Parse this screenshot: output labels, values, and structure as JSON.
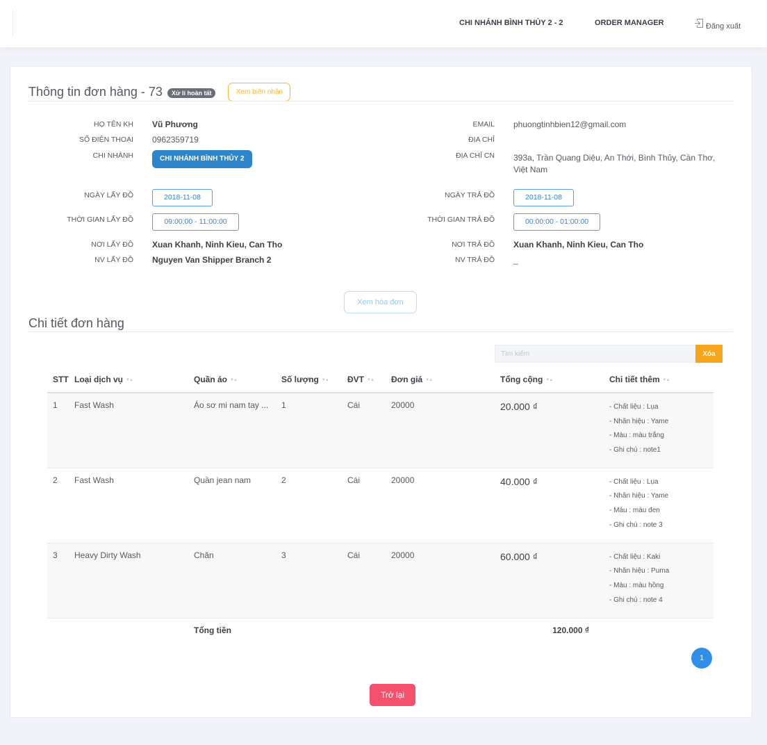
{
  "navbar": {
    "branch": "CHI NHÁNH BÌNH THỦY 2 - 2",
    "role": "ORDER MANAGER",
    "logout_icon": "logout-icon",
    "logout": "Đăng xuất"
  },
  "order": {
    "title": "Thông tin đơn hàng - 73",
    "status": "Xử lí hoàn tất",
    "view_receipt": "Xem biên nhận",
    "customer": {
      "name_label": "HỌ TÊN KH",
      "name": "Vũ Phương",
      "phone_label": "SỐ ĐIỆN THOẠI",
      "phone": "0962359719",
      "branch_label": "CHI NHÁNH",
      "branch": "CHI NHÁNH BÌNH THỦY 2",
      "email_label": "EMAIL",
      "email": "phuongtinhbien12@gmail.com",
      "address_label": "ĐỊA CHỈ",
      "branch_address_label": "ĐỊA CHỈ CN",
      "branch_address": "393a, Trần Quang Diệu, An Thới, Bình Thủy, Cần Thơ, Việt Nam"
    },
    "pickup": {
      "date_label": "NGÀY LẤY ĐỒ",
      "date": "2018-11-08",
      "time_label": "THỜI GIAN LẤY ĐỒ",
      "time": "09:00:00 - 11:00:00",
      "place_label": "NƠI LẤY ĐỒ",
      "place": "Xuan Khanh, Ninh Kieu, Can Tho",
      "staff_label": "NV LẤY ĐỒ",
      "staff": "Nguyen Van Shipper Branch 2"
    },
    "delivery": {
      "date_label": "NGÀY TRẢ ĐỒ",
      "date": "2018-11-08",
      "time_label": "THỜI GIAN TRẢ ĐỒ",
      "time": "00:00:00 - 01:00:00",
      "place_label": "NƠI TRẢ ĐỒ",
      "place": "Xuan Khanh, Ninh Kieu, Can Tho",
      "staff_label": "NV TRẢ ĐỒ",
      "staff": "_"
    },
    "view_invoice": "Xem hóa đơn"
  },
  "details": {
    "heading": "Chi tiết đơn hàng",
    "search_placeholder": "Tìm kiếm",
    "clear_label": "Xóa",
    "sort_icon": "sort-icon",
    "columns": [
      "STT",
      "Loại dịch vụ",
      "Quần áo",
      "Số lượng",
      "ĐVT",
      "Đơn giá",
      "Tổng cộng",
      "Chi tiết thêm"
    ],
    "rows": [
      {
        "stt": "1",
        "service": "Fast Wash",
        "clothing": "Áo sơ mi nam tay ...",
        "quantity": "1",
        "unit": "Cái",
        "unit_price": "20000",
        "line_total": "20.000 ₫",
        "extras": [
          "- Chất liệu : Lụa",
          "- Nhãn hiệu : Yame",
          "- Màu : màu trắng",
          "- Ghi chú : note1"
        ]
      },
      {
        "stt": "2",
        "service": "Fast Wash",
        "clothing": "Quần jean nam",
        "quantity": "2",
        "unit": "Cái",
        "unit_price": "20000",
        "line_total": "40.000 ₫",
        "extras": [
          "- Chất liệu : Lụa",
          "- Nhãn hiệu : Yame",
          "- Màu : màu đen",
          "- Ghi chú : note 3"
        ]
      },
      {
        "stt": "3",
        "service": "Heavy Dirty Wash",
        "clothing": "Chăn",
        "quantity": "3",
        "unit": "Cái",
        "unit_price": "20000",
        "line_total": "60.000 ₫",
        "extras": [
          "- Chất liệu : Kaki",
          "- Nhãn hiệu : Puma",
          "- Màu : màu hồng",
          "- Ghi chú : note 4"
        ]
      }
    ],
    "total_label": "Tổng tiền",
    "grand_total": "120.000 ₫",
    "current_page": "1"
  },
  "actions": {
    "back": "Trở lại"
  },
  "theme": {
    "primary": "#2d86cb",
    "warning": "#ffb822",
    "danger": "#f4516c",
    "info": "#5b9fe2",
    "pagination": "#2f8fe9"
  }
}
